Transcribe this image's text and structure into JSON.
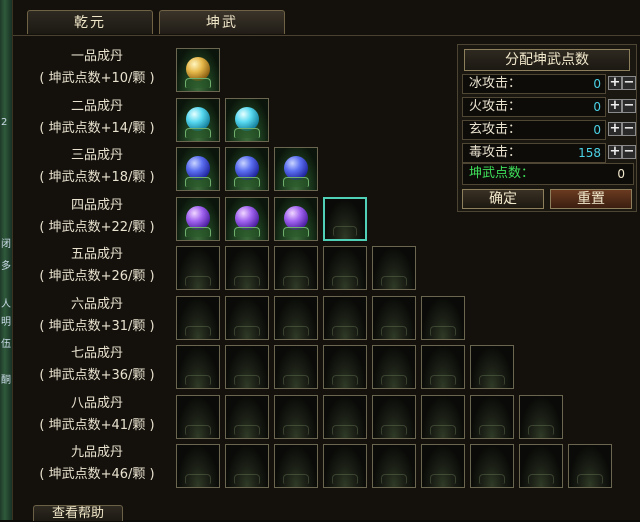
{
  "tabs": [
    {
      "label": "乾元"
    },
    {
      "label": "坤武"
    }
  ],
  "pills": [
    {
      "name": "一品成丹",
      "bonus": "( 坤武点数+10/颗 )",
      "total": 1,
      "filled": 1,
      "orb": "gold",
      "selected": -1
    },
    {
      "name": "二品成丹",
      "bonus": "( 坤武点数+14/颗 )",
      "total": 2,
      "filled": 2,
      "orb": "cyan",
      "selected": -1
    },
    {
      "name": "三品成丹",
      "bonus": "( 坤武点数+18/颗 )",
      "total": 3,
      "filled": 3,
      "orb": "blue",
      "selected": -1
    },
    {
      "name": "四品成丹",
      "bonus": "( 坤武点数+22/颗 )",
      "total": 4,
      "filled": 3,
      "orb": "purple",
      "selected": 3
    },
    {
      "name": "五品成丹",
      "bonus": "( 坤武点数+26/颗 )",
      "total": 5,
      "filled": 0,
      "orb": "",
      "selected": -1
    },
    {
      "name": "六品成丹",
      "bonus": "( 坤武点数+31/颗 )",
      "total": 6,
      "filled": 0,
      "orb": "",
      "selected": -1
    },
    {
      "name": "七品成丹",
      "bonus": "( 坤武点数+36/颗 )",
      "total": 7,
      "filled": 0,
      "orb": "",
      "selected": -1
    },
    {
      "name": "八品成丹",
      "bonus": "( 坤武点数+41/颗 )",
      "total": 8,
      "filled": 0,
      "orb": "",
      "selected": -1
    },
    {
      "name": "九品成丹",
      "bonus": "( 坤武点数+46/颗 )",
      "total": 9,
      "filled": 0,
      "orb": "",
      "selected": -1
    }
  ],
  "allocation": {
    "title": "分配坤武点数",
    "stats": [
      {
        "label": "冰攻击：",
        "value": "0"
      },
      {
        "label": "火攻击：",
        "value": "0"
      },
      {
        "label": "玄攻击：",
        "value": "0"
      },
      {
        "label": "毒攻击：",
        "value": "158"
      }
    ],
    "plus": "+",
    "minus": "−",
    "points_label": "坤武点数：",
    "points_value": "0",
    "confirm_label": "确定",
    "reset_label": "重置"
  },
  "help_label": "查看帮助",
  "side_glyphs": [
    "2",
    "闭",
    "多",
    "人",
    "明",
    "伍",
    "酮"
  ],
  "colors": {
    "stat_value": "#4bd2e6",
    "points_label": "#3ee05a",
    "selected_border": "#4fd0b7"
  }
}
